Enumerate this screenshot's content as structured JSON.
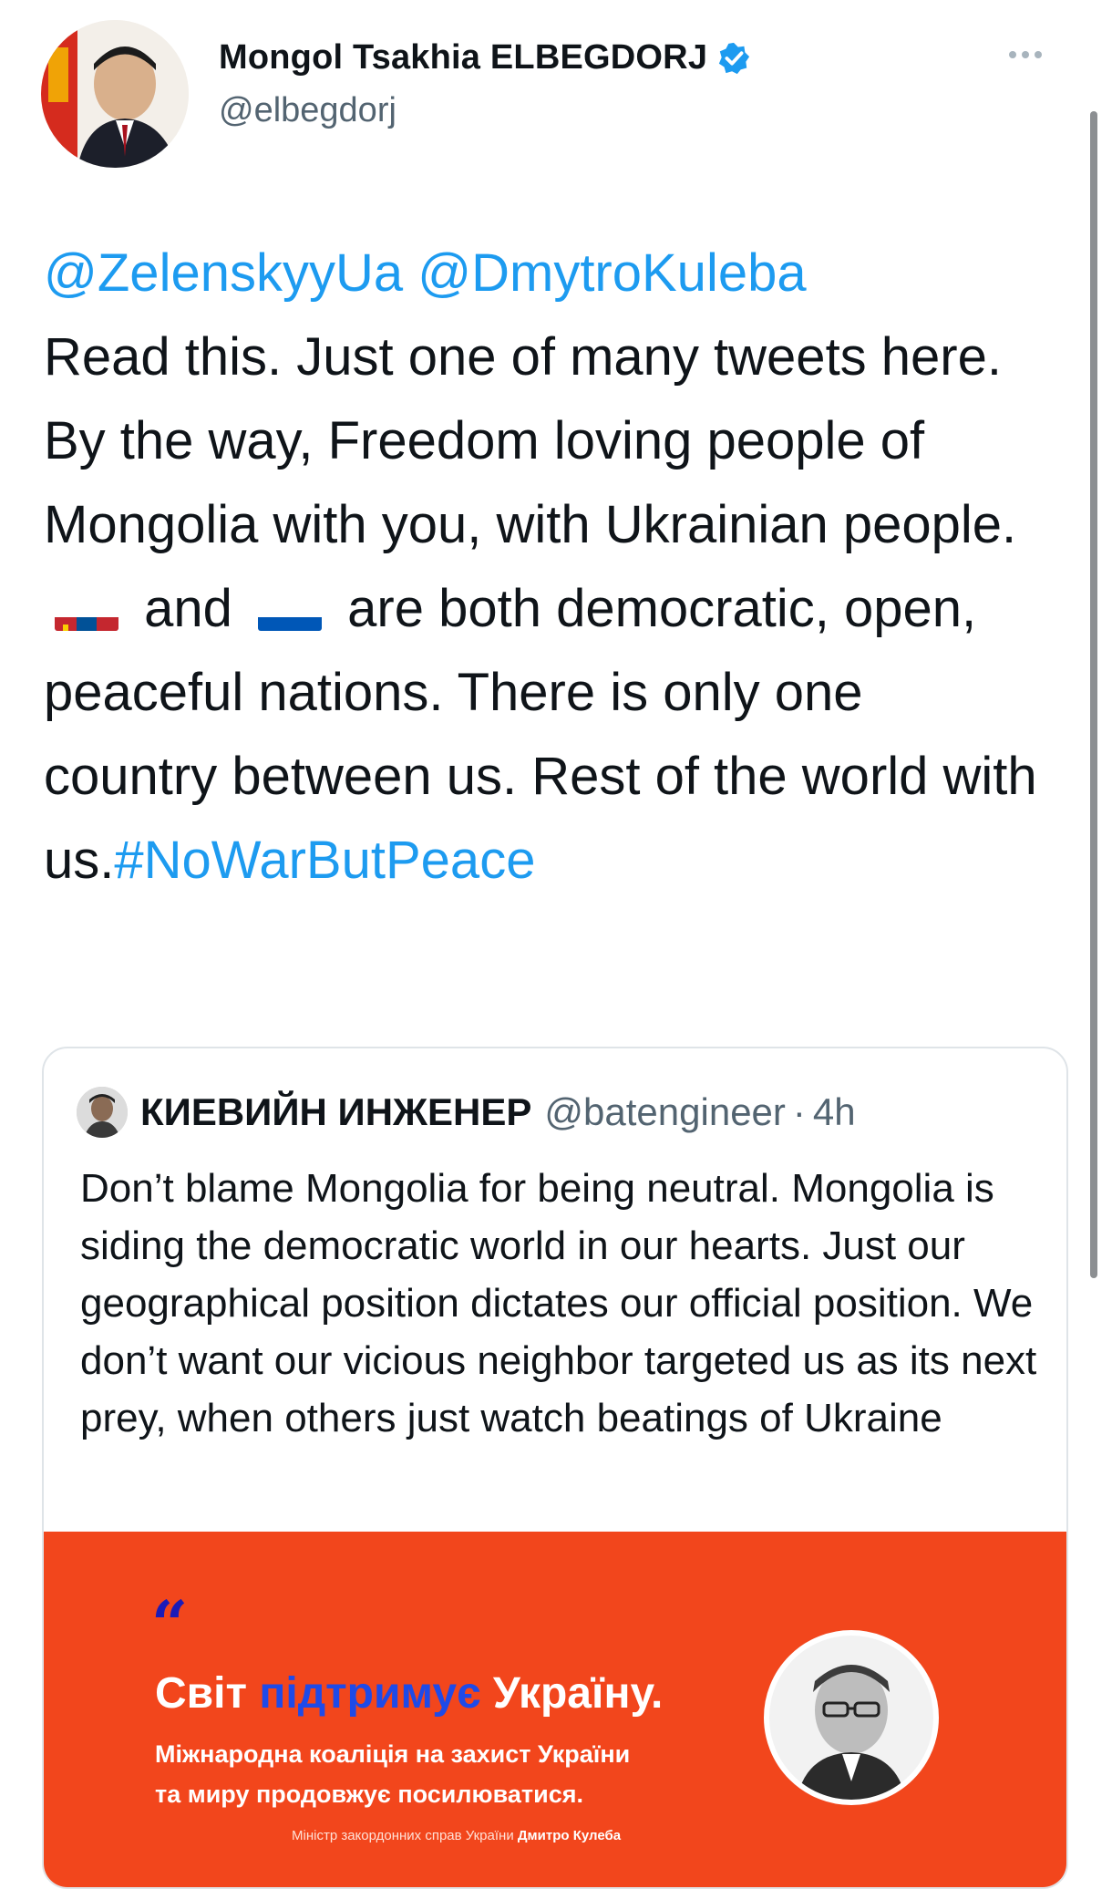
{
  "author": {
    "display_name": "Mongol Tsakhia ELBEGDORJ",
    "handle": "@elbegdorj",
    "avatar": "author-portrait",
    "verified_icon": "verified-badge-icon"
  },
  "tweet": {
    "mentions": [
      "@ZelenskyyUa",
      "@DmytroKuleba"
    ],
    "text_part1": "Read this. Just one of many tweets here. By the way, Freedom loving people of Mongolia with you, with Ukrainian people.",
    "flag_1": "mongolia-flag-icon",
    "and_word": "and",
    "flag_2": "ukraine-flag-icon",
    "text_part2": "are both democratic, open, peaceful nations. There is only one country between us. Rest of the world with us.",
    "hashtag": "#NoWarButPeace"
  },
  "quote": {
    "display_name": "КИЕВИЙН ИНЖЕНЕР",
    "handle": "@batengineer",
    "separator": "·",
    "time": "4h",
    "text": "Don’t blame Mongolia for being neutral. Mongolia is siding the democratic world in our hearts. Just our geographical position dictates our official position. We don’t want our vicious neighbor targeted us as its next prey, when others just watch beatings of Ukraine"
  },
  "banner": {
    "quote_mark": "“",
    "title_a": "Світ",
    "title_b": "підтримує",
    "title_c": "Україну.",
    "subtitle_line1": "Міжнародна коаліція на захист України",
    "subtitle_line2": "та миру продовжує посилюватися.",
    "credit_prefix": "Міністр закордонних справ України",
    "credit_name": "Дмитро Кулеба"
  },
  "colors": {
    "link": "#1d9bf0",
    "banner_bg": "#f2461c",
    "banner_highlight": "#1e4ae8"
  }
}
